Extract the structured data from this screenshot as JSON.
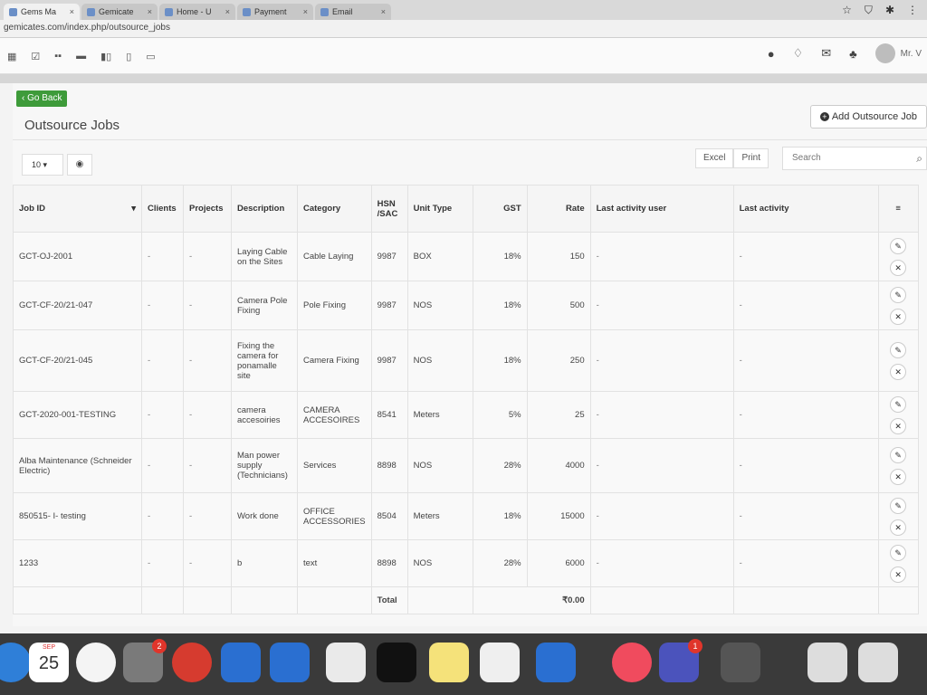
{
  "browser": {
    "tabs": [
      {
        "label": "Gems Ma"
      },
      {
        "label": "Gemicate"
      },
      {
        "label": "Home - U"
      },
      {
        "label": "Payment"
      },
      {
        "label": "Email"
      }
    ],
    "url": "gemicates.com/index.php/outsource_jobs"
  },
  "appbar": {
    "username": "Mr. V"
  },
  "page": {
    "go_back": "‹ Go Back",
    "title": "Outsource Jobs",
    "add_button": "Add Outsource Job",
    "page_size": "10",
    "export_excel": "Excel",
    "export_print": "Print",
    "search_placeholder": "Search"
  },
  "table": {
    "columns": [
      "Job ID",
      "Clients",
      "Projects",
      "Description",
      "Category",
      "HSN /SAC",
      "Unit Type",
      "GST",
      "Rate",
      "Last activity user",
      "Last activity"
    ],
    "rows": [
      {
        "job_id": "GCT-OJ-2001",
        "clients": "-",
        "projects": "-",
        "description": "Laying Cable on the Sites",
        "category": "Cable Laying",
        "hsn": "9987",
        "unit": "BOX",
        "gst": "18%",
        "rate": "150",
        "user": "-",
        "activity": "-"
      },
      {
        "job_id": "GCT-CF-20/21-047",
        "clients": "-",
        "projects": "-",
        "description": "Camera Pole Fixing",
        "category": "Pole Fixing",
        "hsn": "9987",
        "unit": "NOS",
        "gst": "18%",
        "rate": "500",
        "user": "-",
        "activity": "-"
      },
      {
        "job_id": "GCT-CF-20/21-045",
        "clients": "-",
        "projects": "-",
        "description": "Fixing the camera for ponamalle site",
        "category": "Camera Fixing",
        "hsn": "9987",
        "unit": "NOS",
        "gst": "18%",
        "rate": "250",
        "user": "-",
        "activity": "-"
      },
      {
        "job_id": "GCT-2020-001-TESTING",
        "clients": "-",
        "projects": "-",
        "description": "camera accesoiries",
        "category": "CAMERA ACCESOIRES",
        "hsn": "8541",
        "unit": "Meters",
        "gst": "5%",
        "rate": "25",
        "user": "-",
        "activity": "-"
      },
      {
        "job_id": "Alba Maintenance (Schneider Electric)",
        "clients": "-",
        "projects": "-",
        "description": "Man power supply (Technicians)",
        "category": "Services",
        "hsn": "8898",
        "unit": "NOS",
        "gst": "28%",
        "rate": "4000",
        "user": "-",
        "activity": "-"
      },
      {
        "job_id": "850515- I- testing",
        "clients": "-",
        "projects": "-",
        "description": "Work done",
        "category": "OFFICE ACCESSORIES",
        "hsn": "8504",
        "unit": "Meters",
        "gst": "18%",
        "rate": "15000",
        "user": "-",
        "activity": "-"
      },
      {
        "job_id": "1233",
        "clients": "-",
        "projects": "-",
        "description": "b",
        "category": "text",
        "hsn": "8898",
        "unit": "NOS",
        "gst": "28%",
        "rate": "6000",
        "user": "-",
        "activity": "-"
      }
    ],
    "total_label": "Total",
    "total_value": "₹0.00"
  },
  "dock": {
    "calendar_month": "SEP",
    "calendar_day": "25",
    "settings_badge": "2",
    "teams_badge": "1"
  },
  "colors": {
    "go_back_green": "#3e9b3a",
    "dock_bg": "#3a3a3a"
  }
}
